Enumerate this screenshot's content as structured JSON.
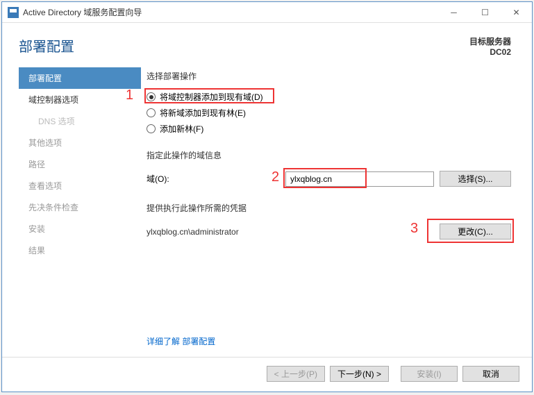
{
  "window": {
    "title": "Active Directory 域服务配置向导"
  },
  "header": {
    "pageTitle": "部署配置",
    "serverLabel": "目标服务器",
    "serverName": "DC02"
  },
  "sidebar": {
    "items": [
      {
        "label": "部署配置"
      },
      {
        "label": "域控制器选项"
      },
      {
        "label": "DNS 选项"
      },
      {
        "label": "其他选项"
      },
      {
        "label": "路径"
      },
      {
        "label": "查看选项"
      },
      {
        "label": "先决条件检查"
      },
      {
        "label": "安装"
      },
      {
        "label": "结果"
      }
    ]
  },
  "content": {
    "deployLabel": "选择部署操作",
    "radio": {
      "opt1": "将域控制器添加到现有域(D)",
      "opt2": "将新域添加到现有林(E)",
      "opt3": "添加新林(F)"
    },
    "domainInfoLabel": "指定此操作的域信息",
    "domainFieldLabel": "域(O):",
    "domainValue": "ylxqblog.cn",
    "selectBtn": "选择(S)...",
    "credsLabel": "提供执行此操作所需的凭据",
    "credsValue": "ylxqblog.cn\\administrator",
    "changeBtn": "更改(C)...",
    "learnMore": "详细了解 部署配置"
  },
  "annotations": {
    "a1": "1",
    "a2": "2",
    "a3": "3"
  },
  "footer": {
    "prev": "< 上一步(P)",
    "next": "下一步(N) >",
    "install": "安装(I)",
    "cancel": "取消"
  }
}
